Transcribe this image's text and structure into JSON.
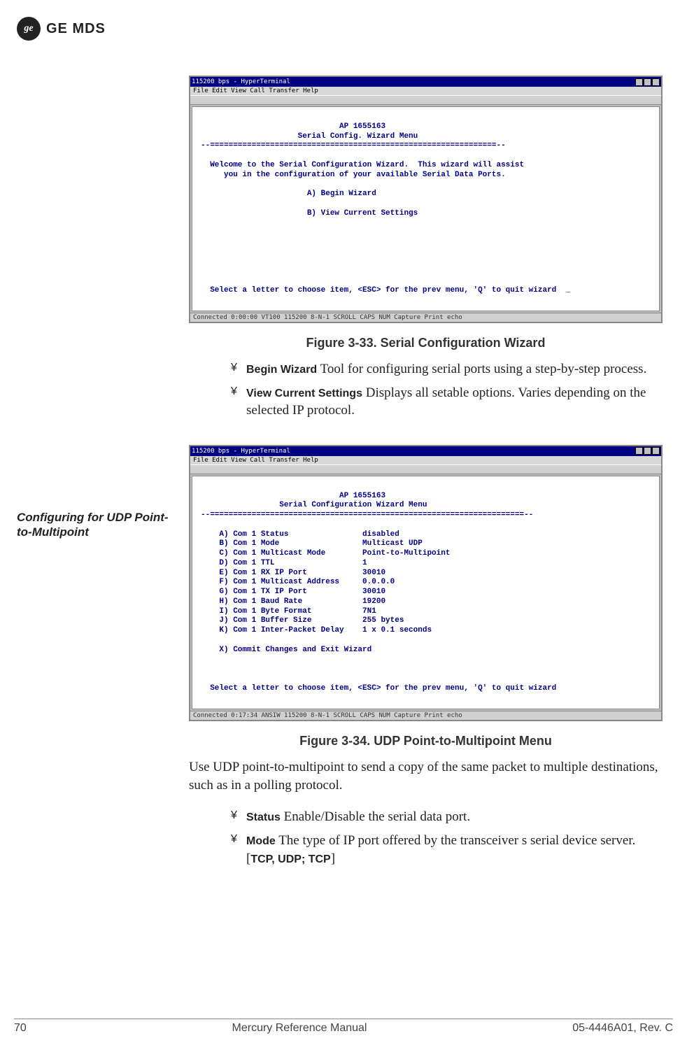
{
  "header": {
    "brand": "GE MDS",
    "monogram": "ge"
  },
  "screenshot1": {
    "title": "115200 bps - HyperTerminal",
    "menubar": "File  Edit  View  Call  Transfer  Help",
    "line_ap": "                              AP 1655163",
    "line_menu": "                     Serial Config. Wizard Menu",
    "line_sep": "--==============================================================--",
    "line_w1": "  Welcome to the Serial Configuration Wizard.  This wizard will assist",
    "line_w2": "     you in the configuration of your available Serial Data Ports.",
    "line_a": "                       A) Begin Wizard",
    "line_b": "                       B) View Current Settings",
    "line_prompt": "  Select a letter to choose item, <ESC> for the prev menu, 'Q' to quit wizard  _",
    "status": "Connected 0:00:00   VT100    115200 8-N-1  SCROLL  CAPS  NUM  Capture  Print echo"
  },
  "caption1": "Figure 3-33. Serial Configuration Wizard",
  "bullets1": {
    "a_label": "Begin Wizard",
    "a_desc": " Tool for configuring serial ports using a step-by-step process.",
    "b_label": "View Current Settings",
    "b_desc": " Displays all setable options. Varies depending on the selected IP protocol."
  },
  "side_heading": "Configuring for UDP Point-to-Multipoint",
  "screenshot2": {
    "title": "115200 bps - HyperTerminal",
    "menubar": "File  Edit  View  Call  Transfer  Help",
    "line_ap": "                              AP 1655163",
    "line_menu": "                 Serial Configuration Wizard Menu",
    "line_sep": "--====================================================================--",
    "r_a": "    A) Com 1 Status                disabled",
    "r_b": "    B) Com 1 Mode                  Multicast UDP",
    "r_c": "    C) Com 1 Multicast Mode        Point-to-Multipoint",
    "r_d": "    D) Com 1 TTL                   1",
    "r_e": "    E) Com 1 RX IP Port            30010",
    "r_f": "    F) Com 1 Multicast Address     0.0.0.0",
    "r_g": "    G) Com 1 TX IP Port            30010",
    "r_h": "    H) Com 1 Baud Rate             19200",
    "r_i": "    I) Com 1 Byte Format           7N1",
    "r_j": "    J) Com 1 Buffer Size           255 bytes",
    "r_k": "    K) Com 1 Inter-Packet Delay    1 x 0.1 seconds",
    "r_x": "    X) Commit Changes and Exit Wizard",
    "line_prompt": "  Select a letter to choose item, <ESC> for the prev menu, 'Q' to quit wizard",
    "status": "Connected 0:17:34   ANSIW    115200 8-N-1  SCROLL  CAPS  NUM  Capture  Print echo"
  },
  "caption2": "Figure 3-34. UDP Point-to-Multipoint Menu",
  "paragraph2": "Use UDP point-to-multipoint to send a copy of the same packet to multiple destinations, such as in a polling protocol.",
  "bullets2": {
    "a_label": "Status",
    "a_desc": " Enable/Disable the serial data port.",
    "b_label": "Mode",
    "b_desc_pre": " The type of IP port offered by the  transceiver   s serial device server. [",
    "b_opts": "TCP, UDP; TCP",
    "b_desc_post": "]"
  },
  "footer": {
    "page": "70",
    "center": "Mercury Reference Manual",
    "rev": "05-4446A01, Rev. C"
  },
  "bullet_glyph": "¥"
}
